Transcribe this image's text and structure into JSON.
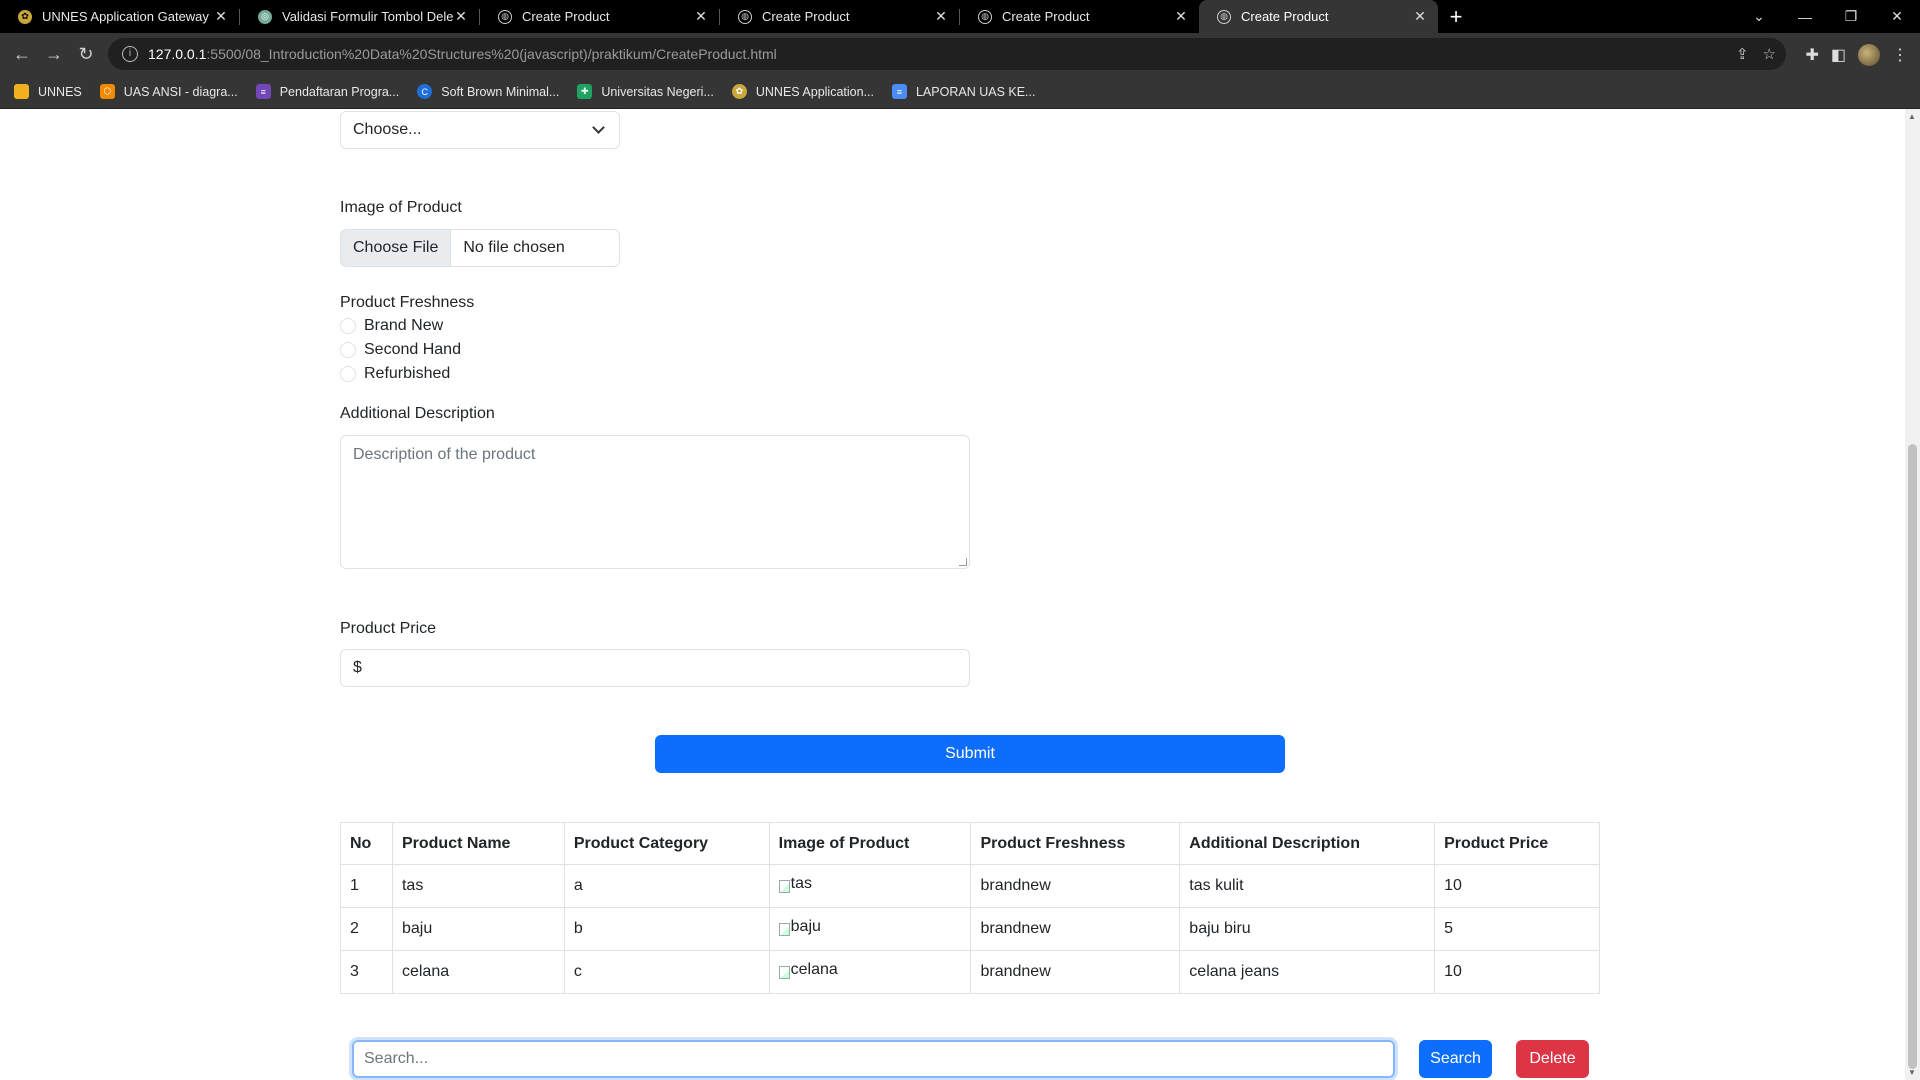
{
  "browser": {
    "tabs": [
      {
        "title": "UNNES Application Gateway (Be",
        "icon": "unnes-icon",
        "active": false
      },
      {
        "title": "Validasi Formulir Tombol Delete",
        "icon": "chatgpt-icon",
        "active": false
      },
      {
        "title": "Create Product",
        "icon": "globe-icon",
        "active": false
      },
      {
        "title": "Create Product",
        "icon": "globe-icon",
        "active": false
      },
      {
        "title": "Create Product",
        "icon": "globe-icon",
        "active": false
      },
      {
        "title": "Create Product",
        "icon": "globe-icon",
        "active": true
      }
    ],
    "url_host": "127.0.0.1",
    "url_rest": ":5500/08_Introduction%20Data%20Structures%20(javascript)/praktikum/CreateProduct.html",
    "bookmarks": [
      {
        "label": "UNNES",
        "color": "#f2b01e"
      },
      {
        "label": "UAS ANSI - diagra...",
        "color": "#f08a00"
      },
      {
        "label": "Pendaftaran Progra...",
        "color": "#7248b9"
      },
      {
        "label": "Soft Brown Minimal...",
        "color": "#1e6fd9"
      },
      {
        "label": "Universitas Negeri...",
        "color": "#1ea362"
      },
      {
        "label": "UNNES Application...",
        "color": "#c9a73a"
      },
      {
        "label": "LAPORAN UAS KE...",
        "color": "#4b8cf5"
      }
    ]
  },
  "form": {
    "category_select_value": "Choose...",
    "image_label": "Image of Product",
    "file_button": "Choose File",
    "file_text": "No file chosen",
    "freshness_label": "Product Freshness",
    "freshness_options": [
      "Brand New",
      "Second Hand",
      "Refurbished"
    ],
    "description_label": "Additional Description",
    "description_placeholder": "Description of the product",
    "price_label": "Product Price",
    "price_value": "$",
    "submit_label": "Submit"
  },
  "table": {
    "headers": [
      "No",
      "Product Name",
      "Product Category",
      "Image of Product",
      "Product Freshness",
      "Additional Description",
      "Product Price"
    ],
    "rows": [
      [
        "1",
        "tas",
        "a",
        "tas",
        "brandnew",
        "tas kulit",
        "10"
      ],
      [
        "2",
        "baju",
        "b",
        "baju",
        "brandnew",
        "baju biru",
        "5"
      ],
      [
        "3",
        "celana",
        "c",
        "celana",
        "brandnew",
        "celana jeans",
        "10"
      ]
    ]
  },
  "search": {
    "placeholder": "Search...",
    "search_button": "Search",
    "delete_button": "Delete"
  }
}
